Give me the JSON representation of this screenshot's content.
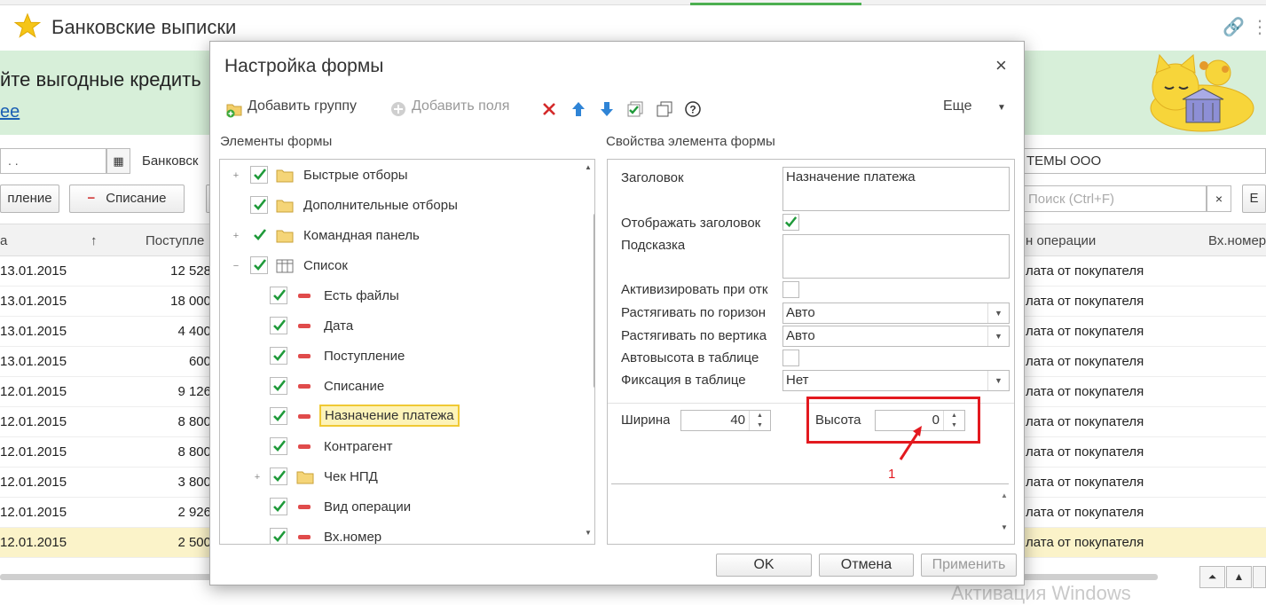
{
  "window": {
    "title": "Банковские выписки"
  },
  "banner": {
    "text": "йте выгодные кредить",
    "link": "ее"
  },
  "filters": {
    "date_value": ".  .",
    "bank_label": "Банковск",
    "org_value": "ТЕМЫ ООО"
  },
  "toolbar": {
    "btn_income": "пление",
    "btn_writeoff": "Списание",
    "btn_writeoff_minus": "−",
    "btn_more": "Е",
    "search_placeholder": "Поиск (Ctrl+F)",
    "search_clear": "×"
  },
  "table": {
    "columns": [
      "а",
      "Поступле",
      "н операции",
      "Вх.номер"
    ],
    "sort_arrow": "↑",
    "rows": [
      {
        "date": "13.01.2015",
        "sum": "12 528",
        "op": "лата от покупателя"
      },
      {
        "date": "13.01.2015",
        "sum": "18 000",
        "op": "лата от покупателя"
      },
      {
        "date": "13.01.2015",
        "sum": "4 400",
        "op": "лата от покупателя"
      },
      {
        "date": "13.01.2015",
        "sum": "600",
        "op": "лата от покупателя"
      },
      {
        "date": "12.01.2015",
        "sum": "9 126",
        "op": "лата от покупателя"
      },
      {
        "date": "12.01.2015",
        "sum": "8 800",
        "op": "лата от покупателя"
      },
      {
        "date": "12.01.2015",
        "sum": "8 800",
        "op": "лата от покупателя"
      },
      {
        "date": "12.01.2015",
        "sum": "3 800",
        "op": "лата от покупателя"
      },
      {
        "date": "12.01.2015",
        "sum": "2 926",
        "op": "лата от покупателя"
      },
      {
        "date": "12.01.2015",
        "sum": "2 500",
        "op": "лата от покупателя"
      }
    ]
  },
  "watermark": "Активация Windows",
  "dialog": {
    "title": "Настройка формы",
    "close": "×",
    "add_group": "Добавить группу",
    "add_fields": "Добавить поля",
    "more": "Еще",
    "elements_title": "Элементы формы",
    "props_title": "Свойства элемента формы",
    "tree": [
      {
        "label": "Быстрые отборы",
        "type": "folder",
        "level": 0,
        "expander": "+"
      },
      {
        "label": "Дополнительные отборы",
        "type": "folder",
        "level": 0,
        "expander": ""
      },
      {
        "label": "Командная панель",
        "type": "folder",
        "level": 0,
        "expander": "+"
      },
      {
        "label": "Список",
        "type": "table",
        "level": 0,
        "expander": "−"
      },
      {
        "label": "Есть файлы",
        "type": "field",
        "level": 1,
        "expander": ""
      },
      {
        "label": "Дата",
        "type": "field",
        "level": 1,
        "expander": ""
      },
      {
        "label": "Поступление",
        "type": "field",
        "level": 1,
        "expander": ""
      },
      {
        "label": "Списание",
        "type": "field",
        "level": 1,
        "expander": ""
      },
      {
        "label": "Назначение платежа",
        "type": "field",
        "level": 1,
        "expander": "",
        "selected": true
      },
      {
        "label": "Контрагент",
        "type": "field",
        "level": 1,
        "expander": ""
      },
      {
        "label": "Чек НПД",
        "type": "folder",
        "level": 1,
        "expander": "+"
      },
      {
        "label": "Вид операции",
        "type": "field",
        "level": 1,
        "expander": ""
      },
      {
        "label": "Вх.номер",
        "type": "field",
        "level": 1,
        "expander": ""
      }
    ],
    "props": {
      "caption_label": "Заголовок",
      "caption_value": "Назначение платежа",
      "show_caption_label": "Отображать заголовок",
      "hint_label": "Подсказка",
      "hint_value": "",
      "activate_label": "Активизировать при отк",
      "stretch_h_label": "Растягивать по горизон",
      "stretch_h_value": "Авто",
      "stretch_v_label": "Растягивать по вертика",
      "stretch_v_value": "Авто",
      "autoheight_label": "Автовысота в таблице",
      "fix_label": "Фиксация в таблице",
      "fix_value": "Нет",
      "width_label": "Ширина",
      "width_value": "40",
      "height_label": "Высота",
      "height_value": "0",
      "annotation": "1"
    },
    "ok": "OK",
    "cancel": "Отмена",
    "apply": "Применить"
  },
  "colors": {
    "accent_green": "#4caf50",
    "banner_bg": "#d7efd9",
    "selection": "#fdf3b8",
    "highlight_red": "#e3191f"
  }
}
